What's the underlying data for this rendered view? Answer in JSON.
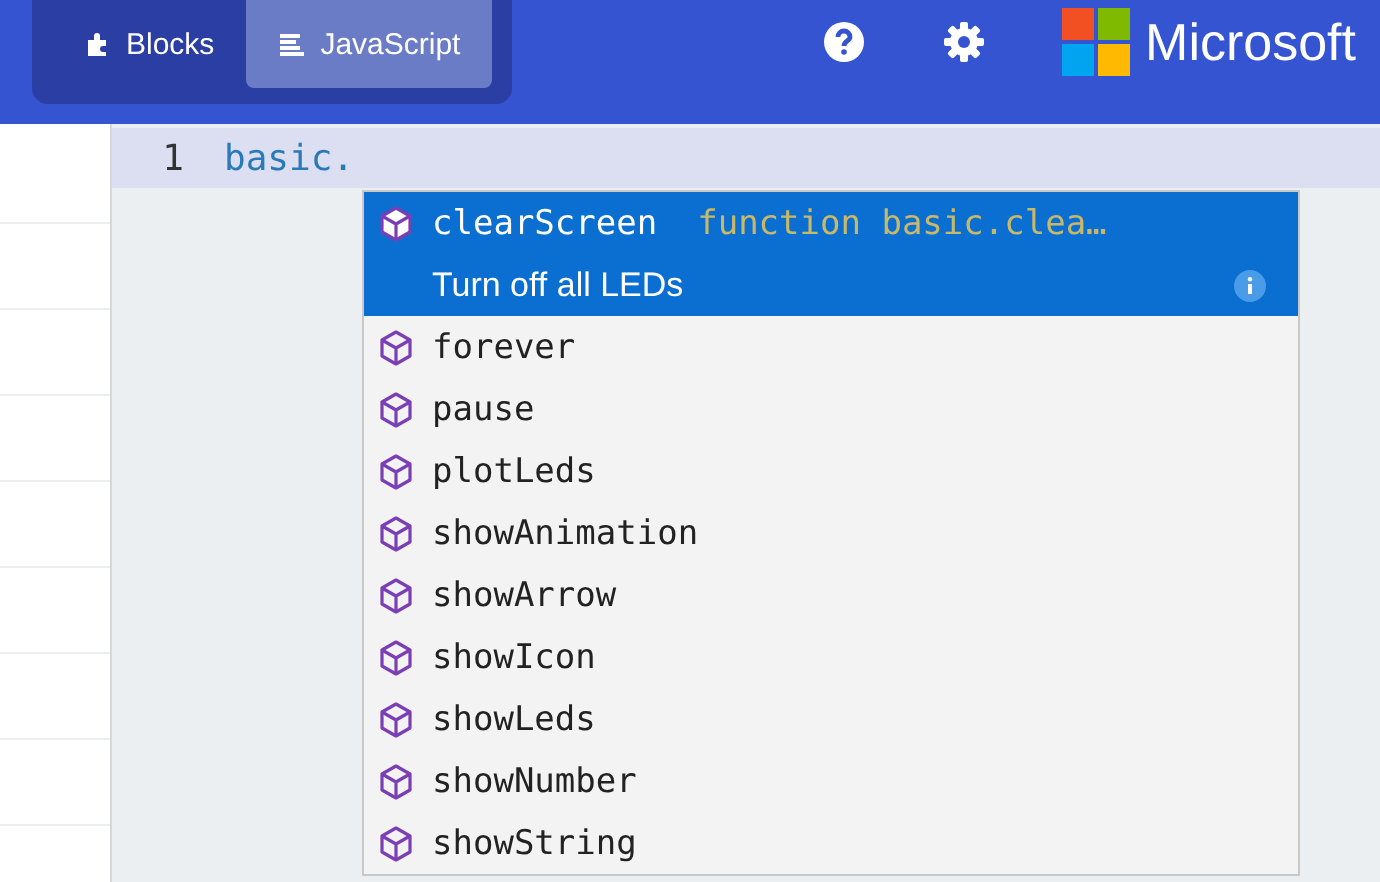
{
  "header": {
    "tabs": [
      {
        "label": "Blocks",
        "selected": false,
        "kind": "blocks"
      },
      {
        "label": "JavaScript",
        "selected": true,
        "kind": "javascript"
      }
    ],
    "brand": "Microsoft"
  },
  "editor": {
    "lines": [
      {
        "number": "1",
        "code": "basic.",
        "selected": true
      }
    ]
  },
  "suggestions": [
    {
      "name": "clearScreen",
      "detail": "function basic.clea…",
      "description": "Turn off all LEDs",
      "selected": true
    },
    {
      "name": "forever",
      "selected": false
    },
    {
      "name": "pause",
      "selected": false
    },
    {
      "name": "plotLeds",
      "selected": false
    },
    {
      "name": "showAnimation",
      "selected": false
    },
    {
      "name": "showArrow",
      "selected": false
    },
    {
      "name": "showIcon",
      "selected": false
    },
    {
      "name": "showLeds",
      "selected": false
    },
    {
      "name": "showNumber",
      "selected": false
    },
    {
      "name": "showString",
      "selected": false
    }
  ]
}
